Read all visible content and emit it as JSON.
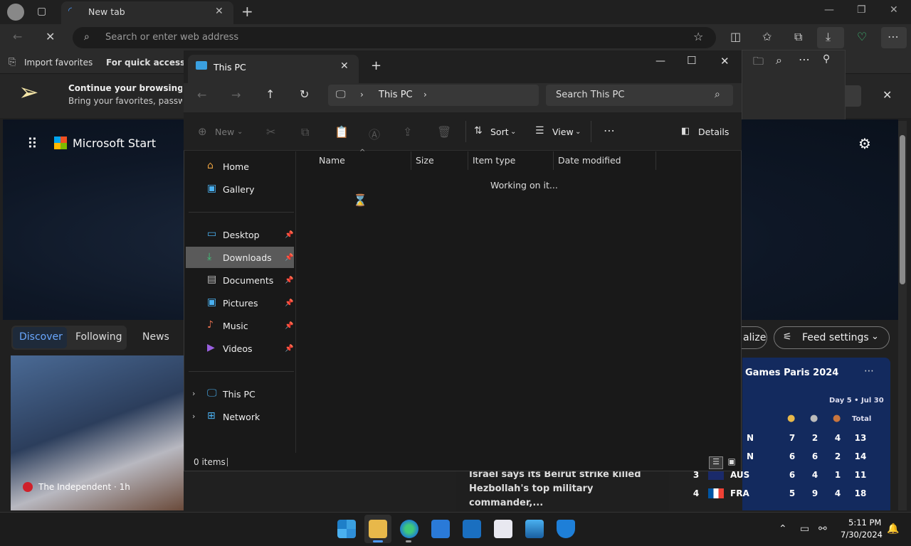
{
  "browser": {
    "tab_title": "New tab",
    "address_placeholder": "Search or enter web address",
    "fav_import": "Import favorites",
    "fav_quick": "For quick access, pla"
  },
  "notification": {
    "line1": "Continue your browsing in Mi",
    "line2": "Bring your favorites, passwords"
  },
  "start": {
    "brand": "Microsoft Start",
    "tabs": [
      "Discover",
      "Following",
      "News"
    ],
    "personalize": "alize",
    "feed_settings": "Feed settings",
    "news_source": "The Independent · 1h",
    "headline_mid": "Israel says its Beirut strike killed Hezbollah's top military commander,...",
    "olympics": {
      "title": "Games Paris 2024",
      "day": "Day 5 • Jul 30",
      "total_label": "Total",
      "rows": [
        {
          "rank": "",
          "country": "N",
          "gold": "7",
          "silver": "2",
          "bronze": "4",
          "total": "13"
        },
        {
          "rank": "",
          "country": "N",
          "gold": "6",
          "silver": "6",
          "bronze": "2",
          "total": "14"
        },
        {
          "rank": "3",
          "country": "AUS",
          "gold": "6",
          "silver": "4",
          "bronze": "1",
          "total": "11"
        },
        {
          "rank": "4",
          "country": "FRA",
          "gold": "5",
          "silver": "9",
          "bronze": "4",
          "total": "18"
        }
      ]
    }
  },
  "explorer": {
    "tab_label": "This PC",
    "breadcrumb": "This PC",
    "search_placeholder": "Search This PC",
    "cmd": {
      "new": "New",
      "sort": "Sort",
      "view": "View",
      "details": "Details"
    },
    "sidebar": {
      "home": "Home",
      "gallery": "Gallery",
      "desktop": "Desktop",
      "downloads": "Downloads",
      "documents": "Documents",
      "pictures": "Pictures",
      "music": "Music",
      "videos": "Videos",
      "thispc": "This PC",
      "network": "Network"
    },
    "columns": {
      "name": "Name",
      "size": "Size",
      "type": "Item type",
      "modified": "Date modified"
    },
    "working": "Working on it...",
    "status": "0 items"
  },
  "taskbar": {
    "time": "5:11 PM",
    "date": "7/30/2024"
  },
  "colors": {
    "accent": "#4c9aff",
    "explorer_bg": "#191919",
    "selected": "#5a5a5a"
  }
}
